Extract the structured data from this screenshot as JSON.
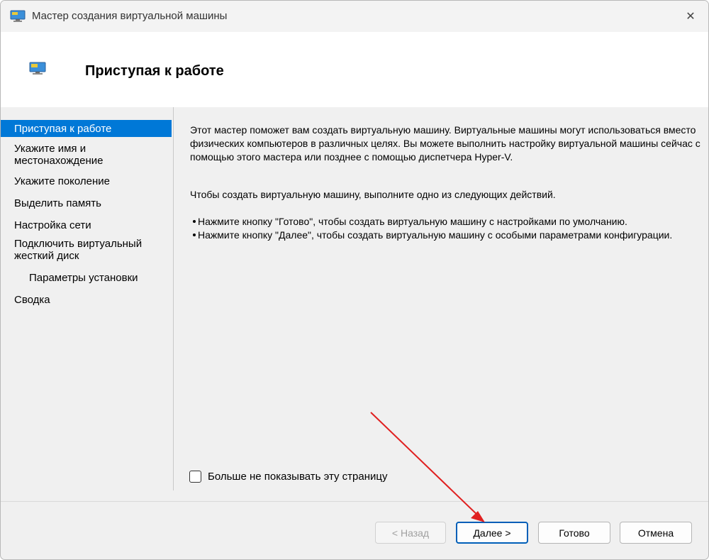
{
  "window": {
    "title": "Мастер создания виртуальной машины",
    "close_glyph": "✕"
  },
  "header": {
    "title": "Приступая к работе"
  },
  "sidebar": {
    "items": [
      {
        "label": "Приступая к работе",
        "active": true
      },
      {
        "label": "Укажите имя и местонахождение"
      },
      {
        "label": "Укажите поколение"
      },
      {
        "label": "Выделить память"
      },
      {
        "label": "Настройка сети"
      },
      {
        "label": "Подключить виртуальный жесткий диск"
      },
      {
        "label": "Параметры установки"
      },
      {
        "label": "Сводка"
      }
    ]
  },
  "content": {
    "intro": "Этот мастер поможет вам создать виртуальную машину. Виртуальные машины могут использоваться вместо физических компьютеров в различных целях. Вы можете выполнить настройку виртуальной машины сейчас с помощью этого мастера или позднее с помощью диспетчера Hyper-V.",
    "instruction": "Чтобы создать виртуальную машину, выполните одно из следующих действий.",
    "bullets": [
      "Нажмите кнопку \"Готово\", чтобы создать виртуальную машину с настройками по умолчанию.",
      "Нажмите кнопку \"Далее\", чтобы создать виртуальную машину с особыми параметрами конфигурации."
    ],
    "dont_show_label": "Больше не показывать эту страницу",
    "dont_show_checked": false
  },
  "footer": {
    "back_label": "< Назад",
    "next_label": "Далее >",
    "finish_label": "Готово",
    "cancel_label": "Отмена"
  },
  "colors": {
    "accent": "#0078d7",
    "annotation_arrow": "#e02020"
  },
  "icons": {
    "title": "monitor-icon",
    "header": "monitor-icon",
    "close": "close-icon"
  }
}
